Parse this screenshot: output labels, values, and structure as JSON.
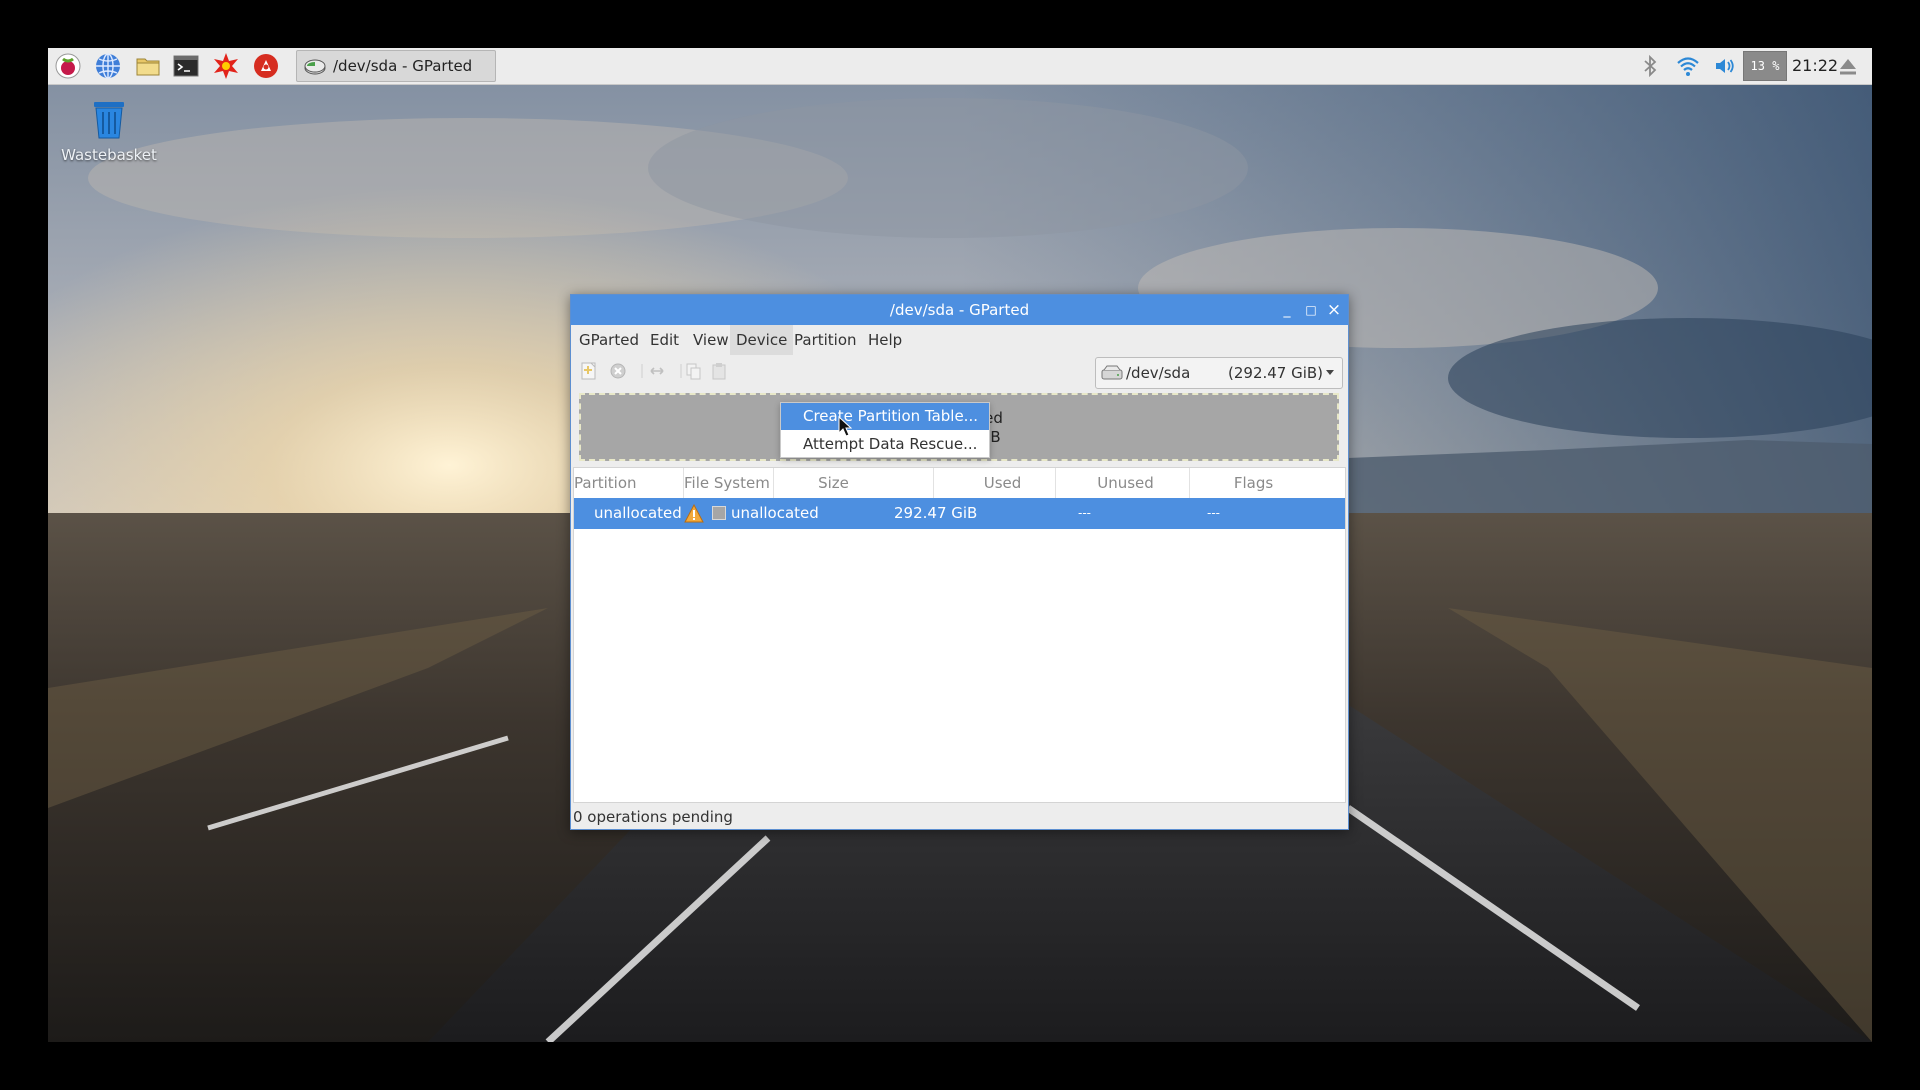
{
  "panel": {
    "launchers": [
      {
        "name": "raspberry-menu-icon"
      },
      {
        "name": "web-browser-icon"
      },
      {
        "name": "file-manager-icon"
      },
      {
        "name": "terminal-icon"
      },
      {
        "name": "mathematica-icon"
      },
      {
        "name": "wolfram-icon"
      }
    ],
    "task_label": "/dev/sda - GParted",
    "cpu_label": "13 %",
    "clock": "21:22",
    "tray_icons": [
      "bluetooth-icon",
      "wifi-icon",
      "volume-icon",
      "eject-icon"
    ]
  },
  "desktop": {
    "wastebasket_label": "Wastebasket"
  },
  "window": {
    "title": "/dev/sda - GParted",
    "controls": {
      "minimize": "_",
      "maximize": "□",
      "close": "×"
    },
    "menus": [
      "GParted",
      "Edit",
      "View",
      "Device",
      "Partition",
      "Help"
    ],
    "active_menu": "Device",
    "device_menu_items": [
      "Create Partition Table...",
      "Attempt Data Rescue..."
    ],
    "highlighted_item": "Create Partition Table...",
    "device_selector": {
      "name": "/dev/sda",
      "size": "(292.47 GiB)"
    },
    "disk_map": {
      "label": "unallocated",
      "size": "292.47 GiB"
    },
    "table": {
      "columns": [
        "Partition",
        "File System",
        "Size",
        "Used",
        "Unused",
        "Flags"
      ],
      "rows": [
        {
          "partition": "unallocated",
          "filesystem": "unallocated",
          "size": "292.47 GiB",
          "used": "---",
          "unused": "---",
          "flags": ""
        }
      ]
    },
    "status": "0 operations pending"
  },
  "colors": {
    "accent": "#4d8fe0",
    "panel": "#ececec",
    "window_bg": "#ededed",
    "unallocated": "#a6a6a6"
  }
}
